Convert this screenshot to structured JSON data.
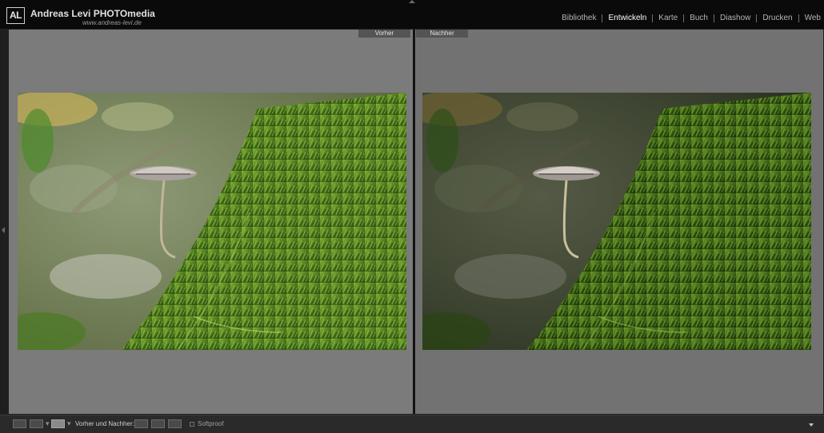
{
  "identity": {
    "logo_text": "AL",
    "name": "Andreas Levi PHOTOmedia",
    "url": "www.andreas-levi.de"
  },
  "modules": [
    {
      "label": "Bibliothek",
      "active": false
    },
    {
      "label": "Entwickeln",
      "active": true
    },
    {
      "label": "Karte",
      "active": false
    },
    {
      "label": "Buch",
      "active": false
    },
    {
      "label": "Diashow",
      "active": false
    },
    {
      "label": "Drucken",
      "active": false
    },
    {
      "label": "Web",
      "active": false
    }
  ],
  "compare": {
    "before_label": "Vorher",
    "after_label": "Nachher"
  },
  "toolbar": {
    "before_after_label": "Vorher und Nachher:",
    "softproof_label": "Softproof",
    "softproof_checked": false
  },
  "colors": {
    "moss_light": "#6f9a2f",
    "moss_dark": "#2c4a12",
    "accent_active": "#ffffff"
  }
}
